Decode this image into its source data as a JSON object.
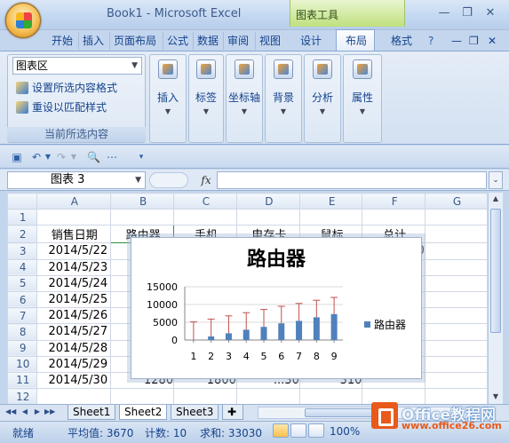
{
  "app": {
    "window_title": "Book1 - Microsoft Excel",
    "context_tab": "图表工具"
  },
  "ribbon": {
    "tabs": [
      "开始",
      "插入",
      "页面布局",
      "公式",
      "数据",
      "审阅",
      "视图",
      "设计",
      "布局",
      "格式"
    ],
    "active_tab": "布局",
    "current_selection": {
      "selector_value": "图表区",
      "format_selection": "设置所选内容格式",
      "reset_style": "重设以匹配样式",
      "group_label": "当前所选内容"
    },
    "buttons": [
      "插入",
      "标签",
      "坐标轴",
      "背景",
      "分析",
      "属性"
    ]
  },
  "formula_bar": {
    "name_box": "图表 3",
    "fx_label": "fx",
    "value": ""
  },
  "sheet": {
    "columns": [
      "A",
      "B",
      "C",
      "D",
      "E",
      "F",
      "G"
    ],
    "rows": [
      "1",
      "2",
      "3",
      "4",
      "5",
      "6",
      "7",
      "8",
      "9",
      "10",
      "11",
      "12"
    ],
    "header_row": [
      "销售日期",
      "路由器",
      "手机",
      "电存卡",
      "鼠标",
      "总计"
    ],
    "dates": [
      "2014/5/22",
      "2014/5/23",
      "2014/5/24",
      "2014/5/25",
      "2014/5/26",
      "2014/5/27",
      "2014/5/28",
      "2014/5/29",
      "2014/5/30"
    ],
    "row11_partial": [
      "1280",
      "1800",
      "...30",
      "310"
    ],
    "row3_f_partial": "0"
  },
  "chart_data": {
    "type": "bar",
    "title": "路由器",
    "categories": [
      "1",
      "2",
      "3",
      "4",
      "5",
      "6",
      "7",
      "8",
      "9"
    ],
    "series": [
      {
        "name": "路由器",
        "values": [
          0,
          1000,
          1900,
          2900,
          3700,
          4700,
          5400,
          6400,
          7300
        ]
      }
    ],
    "error_bar_top": [
      5100,
      5900,
      6800,
      7700,
      8600,
      9500,
      10300,
      11200,
      12000
    ],
    "ylim": [
      0,
      15000
    ],
    "yticks": [
      "0",
      "5000",
      "10000",
      "15000"
    ],
    "grid": true,
    "legend": "right",
    "colors": {
      "bar": "#4f81bd",
      "error": "#c0504d",
      "grid": "#d9d9d9"
    }
  },
  "sheet_tabs": [
    "Sheet1",
    "Sheet2",
    "Sheet3"
  ],
  "active_sheet": "Sheet2",
  "status": {
    "ready": "就绪",
    "average": "平均值: 3670",
    "count": "计数: 10",
    "sum": "求和: 33030",
    "zoom": "100%"
  },
  "watermark": {
    "text": "Office教程网",
    "url": "www.office26.com"
  }
}
